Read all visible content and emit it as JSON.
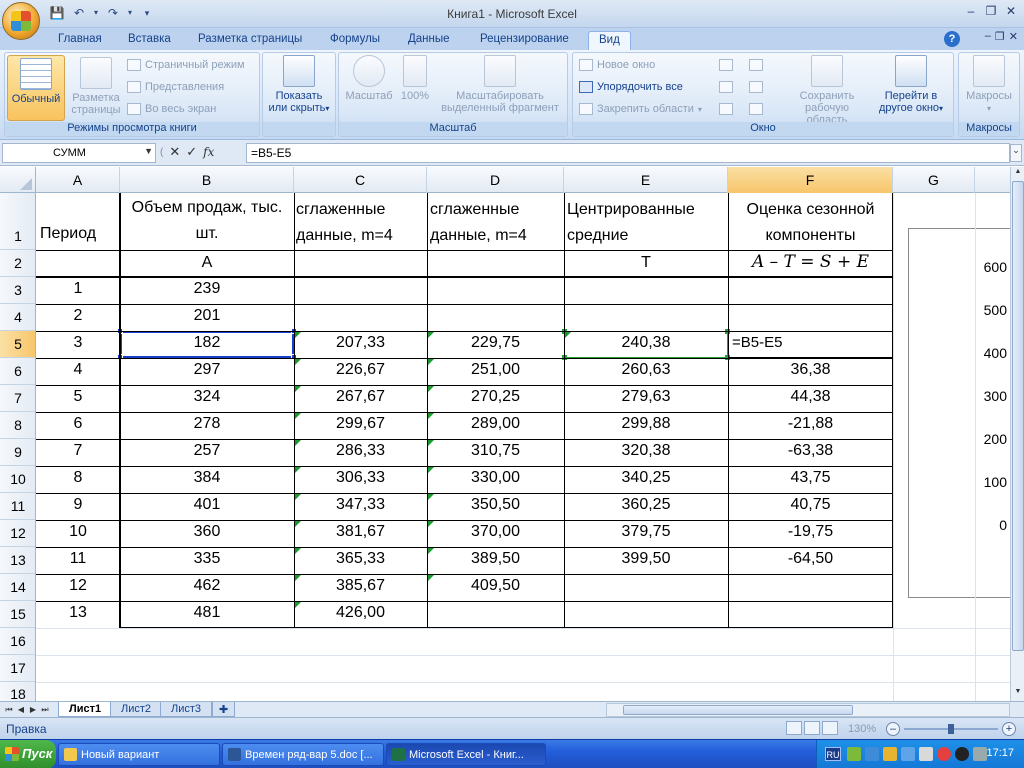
{
  "window": {
    "title": "Книга1 - Microsoft Excel"
  },
  "ribbon_tabs": [
    "Главная",
    "Вставка",
    "Разметка страницы",
    "Формулы",
    "Данные",
    "Рецензирование",
    "Вид"
  ],
  "active_tab": "Вид",
  "ribbon": {
    "views": {
      "label": "Режимы просмотра книги",
      "normal": "Обычный",
      "page_layout_1": "Разметка",
      "page_layout_2": "страницы",
      "page_break": "Страничный режим",
      "custom_views": "Представления",
      "full_screen": "Во весь экран"
    },
    "show_hide": {
      "line1": "Показать",
      "line2": "или скрыть"
    },
    "zoom": {
      "label": "Масштаб",
      "zoom": "Масштаб",
      "hundred": "100%",
      "zoom_sel_1": "Масштабировать",
      "zoom_sel_2": "выделенный фрагмент"
    },
    "window": {
      "label": "Окно",
      "new_window": "Новое окно",
      "arrange_all": "Упорядочить все",
      "freeze": "Закрепить области",
      "save_ws_1": "Сохранить",
      "save_ws_2": "рабочую область",
      "switch_1": "Перейти в",
      "switch_2": "другое окно"
    },
    "macros": {
      "label": "Макросы",
      "button": "Макросы"
    }
  },
  "formula_bar": {
    "name_box": "СУММ",
    "fx": "fx",
    "formula": "=B5-E5"
  },
  "columns": [
    "A",
    "B",
    "C",
    "D",
    "E",
    "F",
    "G"
  ],
  "rows": [
    "1",
    "2",
    "3",
    "4",
    "5",
    "6",
    "7",
    "8",
    "9",
    "10",
    "11",
    "12",
    "13",
    "14",
    "15",
    "16",
    "17",
    "18"
  ],
  "header_row": {
    "A": "Период",
    "B": "Объем продаж, тыс. шт.",
    "C": "сглаженные данные, m=4",
    "D": "сглаженные данные, m=4",
    "E": "Центрированные средние",
    "F": "Оценка сезонной компоненты"
  },
  "symbol_row": {
    "B": "A",
    "E": "T",
    "F": "A – T = S + E"
  },
  "data_rows": [
    {
      "A": "1",
      "B": "239",
      "C": "",
      "D": "",
      "E": "",
      "F": ""
    },
    {
      "A": "2",
      "B": "201",
      "C": "",
      "D": "",
      "E": "",
      "F": ""
    },
    {
      "A": "3",
      "B": "182",
      "C": "207,33",
      "D": "229,75",
      "E": "240,38",
      "F": "=B5-E5"
    },
    {
      "A": "4",
      "B": "297",
      "C": "226,67",
      "D": "251,00",
      "E": "260,63",
      "F": "36,38"
    },
    {
      "A": "5",
      "B": "324",
      "C": "267,67",
      "D": "270,25",
      "E": "279,63",
      "F": "44,38"
    },
    {
      "A": "6",
      "B": "278",
      "C": "299,67",
      "D": "289,00",
      "E": "299,88",
      "F": "-21,88"
    },
    {
      "A": "7",
      "B": "257",
      "C": "286,33",
      "D": "310,75",
      "E": "320,38",
      "F": "-63,38"
    },
    {
      "A": "8",
      "B": "384",
      "C": "306,33",
      "D": "330,00",
      "E": "340,25",
      "F": "43,75"
    },
    {
      "A": "9",
      "B": "401",
      "C": "347,33",
      "D": "350,50",
      "E": "360,25",
      "F": "40,75"
    },
    {
      "A": "10",
      "B": "360",
      "C": "381,67",
      "D": "370,00",
      "E": "379,75",
      "F": "-19,75"
    },
    {
      "A": "11",
      "B": "335",
      "C": "365,33",
      "D": "389,50",
      "E": "399,50",
      "F": "-64,50"
    },
    {
      "A": "12",
      "B": "462",
      "C": "385,67",
      "D": "409,50",
      "E": "",
      "F": ""
    },
    {
      "A": "13",
      "B": "481",
      "C": "426,00",
      "D": "",
      "E": "",
      "F": ""
    }
  ],
  "chart_axis_ticks": [
    "600",
    "500",
    "400",
    "300",
    "200",
    "100",
    "0",
    "0"
  ],
  "sheets": [
    "Лист1",
    "Лист2",
    "Лист3"
  ],
  "active_sheet": "Лист1",
  "status": {
    "mode": "Правка",
    "zoom": "130%"
  },
  "taskbar": {
    "start": "Пуск",
    "items": [
      "Новый вариант",
      "Времен ряд-вар 5.doc [...",
      "Microsoft Excel - Книг..."
    ],
    "lang": "RU",
    "clock": "17:17"
  }
}
